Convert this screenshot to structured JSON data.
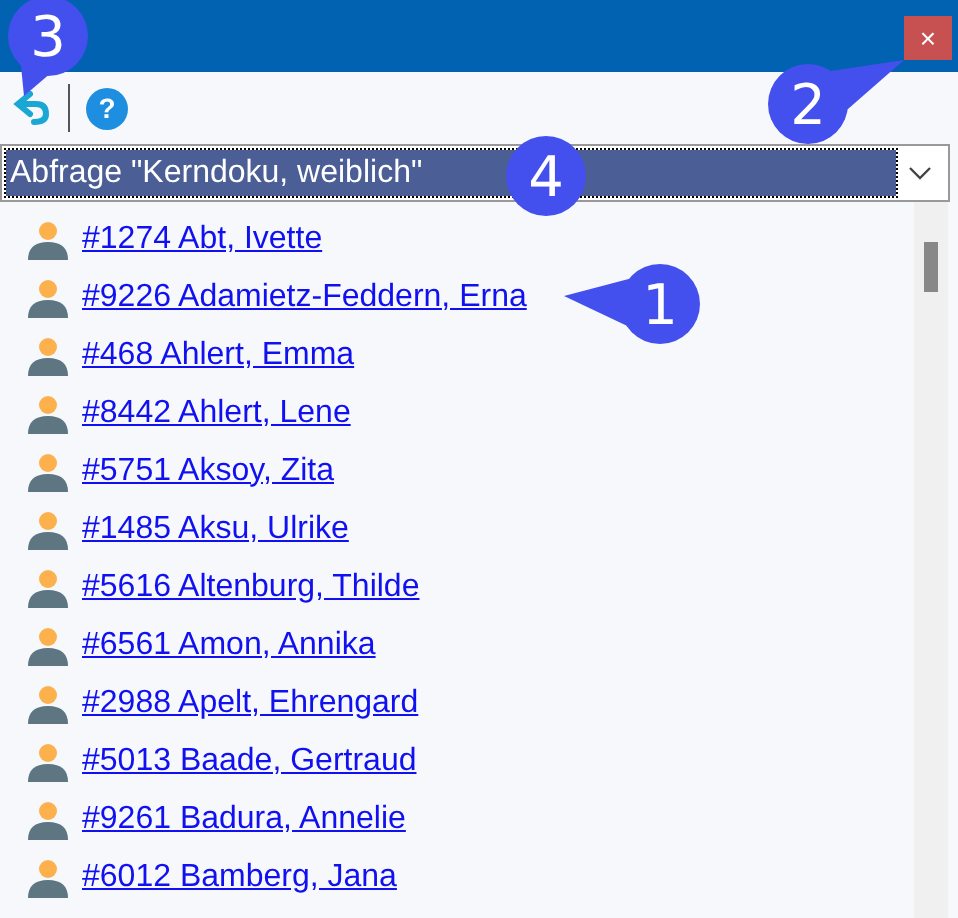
{
  "window": {
    "close_label": "×"
  },
  "toolbar": {
    "help_label": "?"
  },
  "query_select": {
    "value": "Abfrage \"Kerndoku, weiblich\"",
    "selected": true
  },
  "persons": [
    {
      "label": "#1274 Abt, Ivette"
    },
    {
      "label": "#9226 Adamietz-Feddern, Erna"
    },
    {
      "label": "#468 Ahlert, Emma"
    },
    {
      "label": "#8442 Ahlert, Lene"
    },
    {
      "label": "#5751 Aksoy, Zita"
    },
    {
      "label": "#1485 Aksu, Ulrike"
    },
    {
      "label": "#5616 Altenburg, Thilde"
    },
    {
      "label": "#6561 Amon, Annika"
    },
    {
      "label": "#2988 Apelt, Ehrengard"
    },
    {
      "label": "#5013 Baade, Gertraud"
    },
    {
      "label": "#9261 Badura, Annelie"
    },
    {
      "label": "#6012 Bamberg, Jana"
    }
  ],
  "callouts": [
    {
      "label": "3",
      "kind": "down-left"
    },
    {
      "label": "2",
      "kind": "up-right"
    },
    {
      "label": "4",
      "kind": "plain"
    },
    {
      "label": "1",
      "kind": "left"
    }
  ]
}
